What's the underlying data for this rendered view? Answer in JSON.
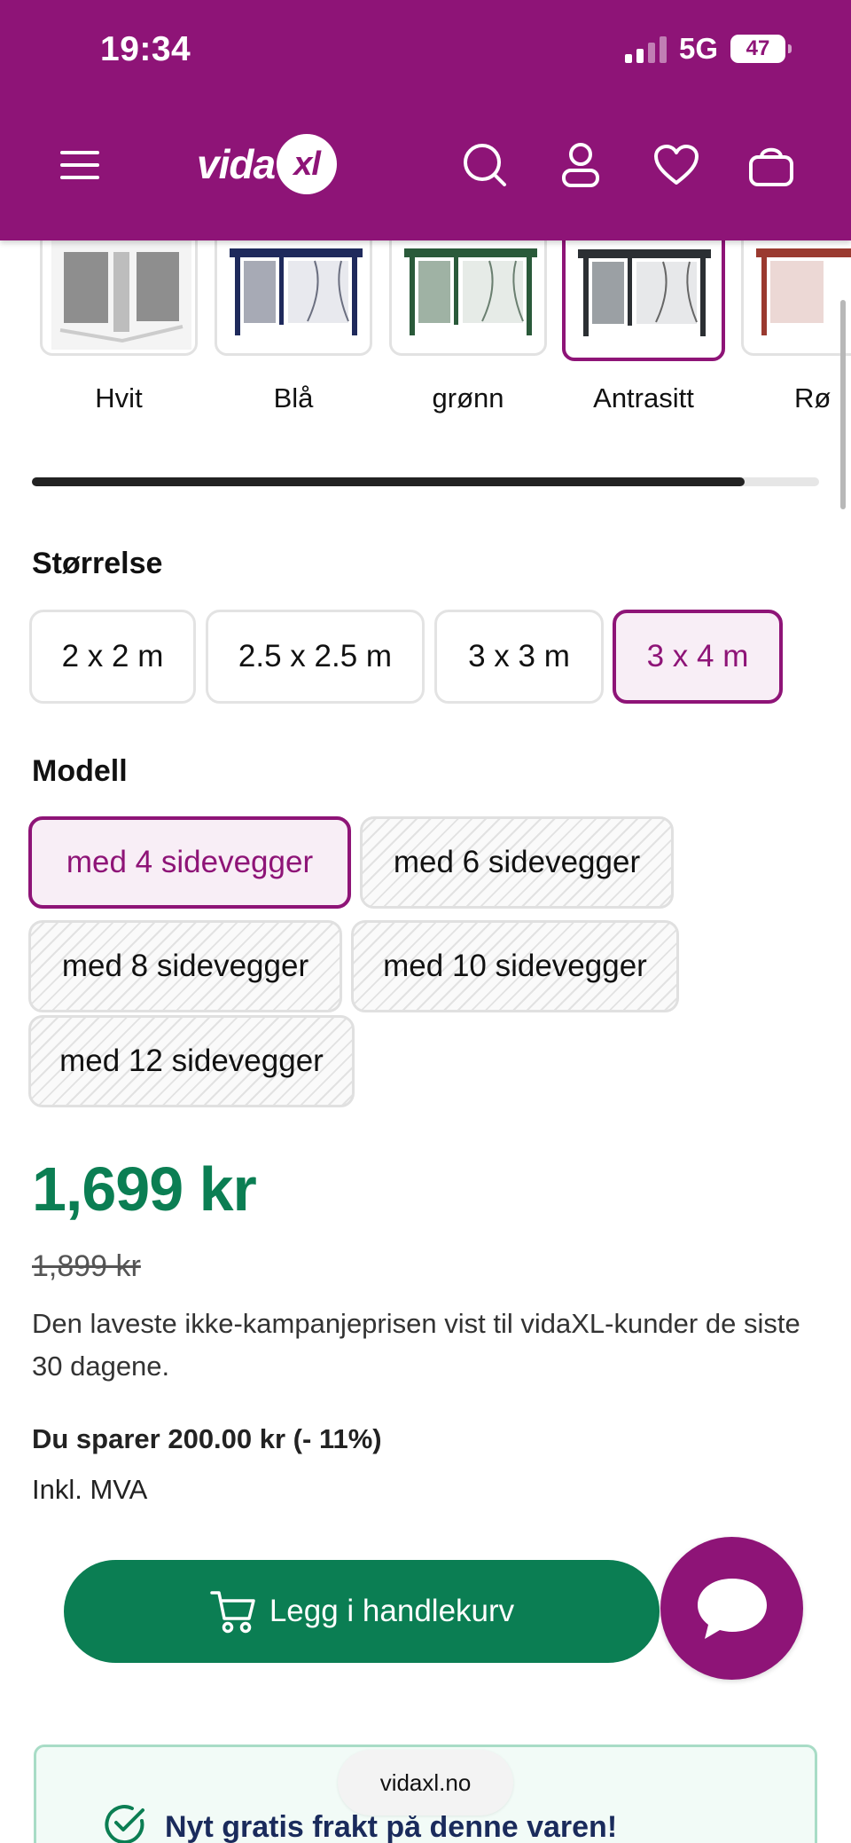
{
  "status_bar": {
    "time": "19:34",
    "network": "5G",
    "battery": "47"
  },
  "header": {
    "logo_text": "vida",
    "logo_badge": "xl",
    "icons": [
      "menu-icon",
      "search-icon",
      "account-icon",
      "heart-icon",
      "cart-icon"
    ]
  },
  "colors": {
    "label_items": [
      "Hvit",
      "Blå",
      "grønn",
      "Antrasitt",
      "Rø"
    ],
    "selected": "Antrasitt",
    "carousel_scroll_fraction": 0.905
  },
  "size": {
    "title": "Størrelse",
    "options": [
      "2 x 2 m",
      "2.5 x 2.5 m",
      "3 x 3 m",
      "3 x 4 m"
    ],
    "selected": "3 x 4 m"
  },
  "model": {
    "title": "Modell",
    "options": [
      "med 4 sidevegger",
      "med 6 sidevegger",
      "med 8 sidevegger",
      "med 10 sidevegger",
      "med 12 sidevegger"
    ],
    "selected": "med 4 sidevegger"
  },
  "pricing": {
    "price": "1,699 kr",
    "old_price": "1,899 kr",
    "note": "Den laveste ikke-kampanjeprisen vist til vidaXL-kunder de siste 30 dagene.",
    "savings": "Du sparer 200.00 kr (- 11%)",
    "vat": "Inkl. MVA"
  },
  "actions": {
    "add_to_cart": "Legg i handlekurv"
  },
  "shipping_banner": {
    "text": "Nyt gratis frakt på denne varen!"
  },
  "browser": {
    "url": "vidaxl.no"
  },
  "theme": {
    "brand": "#8e1477",
    "price_green": "#0b7e53"
  }
}
